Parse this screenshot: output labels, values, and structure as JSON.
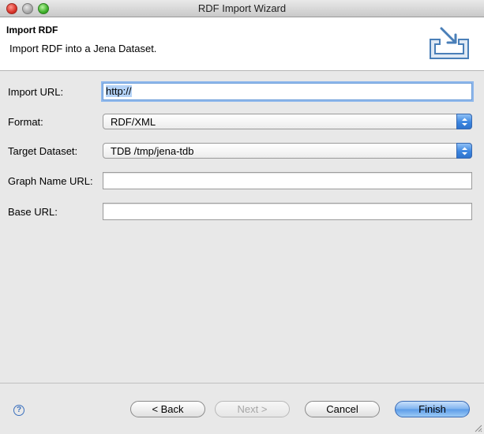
{
  "window": {
    "title": "RDF Import Wizard"
  },
  "header": {
    "title": "Import RDF",
    "description": "Import RDF into a Jena Dataset.",
    "icon": "import-arrow-icon"
  },
  "form": {
    "import_url": {
      "label": "Import URL:",
      "value": "http://"
    },
    "format": {
      "label": "Format:",
      "selected": "RDF/XML"
    },
    "target_dataset": {
      "label": "Target Dataset:",
      "selected": "TDB /tmp/jena-tdb"
    },
    "graph_name_url": {
      "label": "Graph Name URL:",
      "value": ""
    },
    "base_url": {
      "label": "Base URL:",
      "value": ""
    }
  },
  "footer": {
    "help_icon": "help-icon",
    "back_label": "< Back",
    "next_label": "Next >",
    "cancel_label": "Cancel",
    "finish_label": "Finish"
  },
  "colors": {
    "accent": "#3c86e0",
    "focus_ring": "#8fb8ec",
    "selection": "#b5d3f7"
  }
}
